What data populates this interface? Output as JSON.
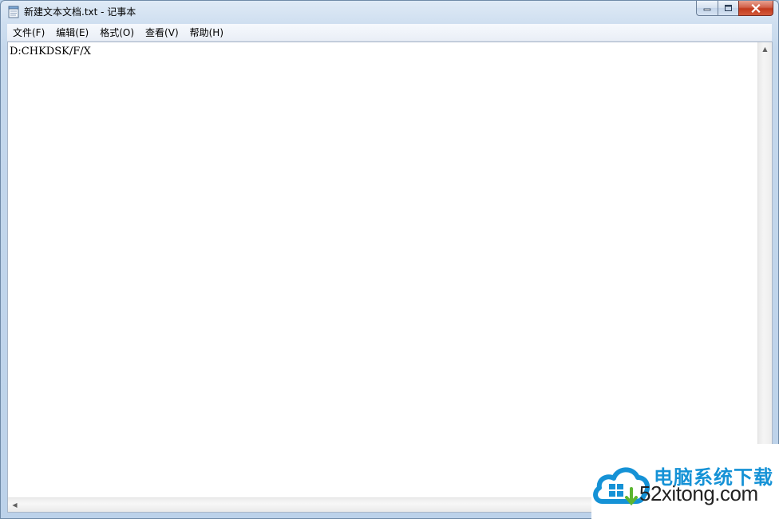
{
  "window": {
    "title": "新建文本文档.txt - 记事本",
    "icon": "notepad-icon"
  },
  "caption": {
    "minimize_icon": "minimize-icon",
    "maximize_icon": "maximize-icon",
    "close_icon": "close-icon"
  },
  "menu": {
    "items": [
      {
        "label": "文件(F)"
      },
      {
        "label": "编辑(E)"
      },
      {
        "label": "格式(O)"
      },
      {
        "label": "查看(V)"
      },
      {
        "label": "帮助(H)"
      }
    ]
  },
  "editor": {
    "content": "D:CHKDSK/F/X"
  },
  "watermark": {
    "cn_text": "电脑系统下载",
    "en_text": "52xitong.com",
    "logo_icon": "cloud-logo-icon",
    "colors": {
      "brand": "#1592d6"
    }
  },
  "colors": {
    "close_button": "#c2391c",
    "titlebar": "#cfdff0"
  }
}
